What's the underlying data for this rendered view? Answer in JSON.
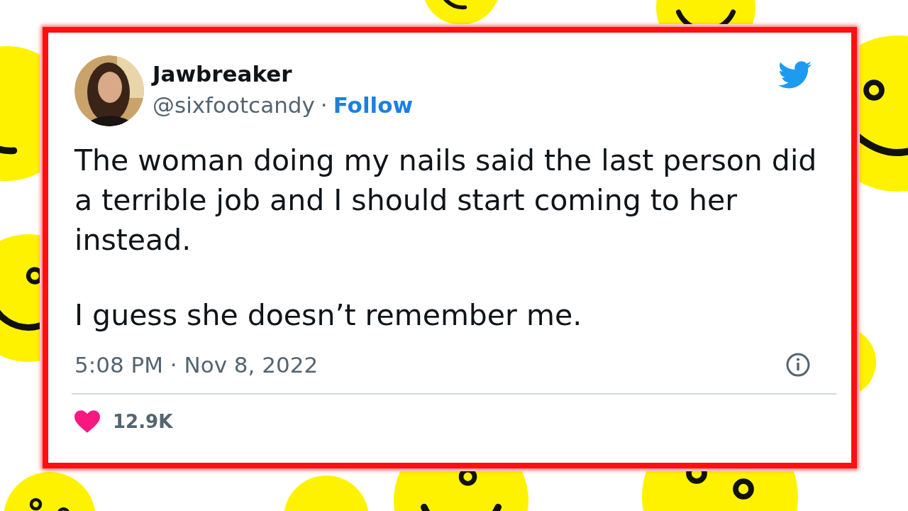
{
  "tweet": {
    "author": {
      "name": "Jawbreaker",
      "handle": "@sixfootcandy",
      "separator": "·",
      "follow": "Follow"
    },
    "paragraphs": [
      "The woman doing my nails said the last person did a terrible job and I should start coming to her instead.",
      "I guess she doesn’t remember me."
    ],
    "timestamp": "5:08 PM · Nov 8, 2022",
    "likes": "12.9K"
  }
}
